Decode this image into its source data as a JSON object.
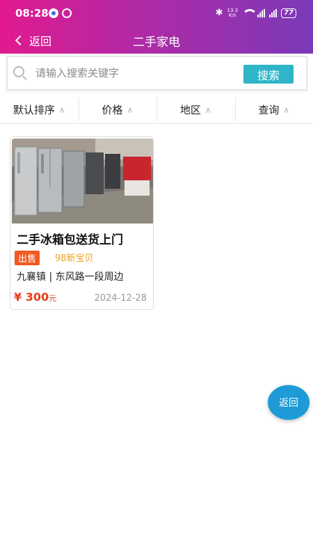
{
  "status_bar": {
    "time": "08:28",
    "network_speed_value": "13.3",
    "network_speed_unit": "K/s",
    "battery": "77"
  },
  "nav": {
    "back_label": "返回",
    "title": "二手家电"
  },
  "search": {
    "placeholder": "请输入搜索关键字",
    "value": "",
    "button_label": "搜索"
  },
  "filters": [
    {
      "label": "默认排序"
    },
    {
      "label": "价格"
    },
    {
      "label": "地区"
    },
    {
      "label": "查询"
    }
  ],
  "listings": [
    {
      "title": "二手冰箱包送货上门",
      "type_tag": "出售",
      "condition": "98新宝贝",
      "location": "九襄镇 | 东风路一段周边",
      "price_symbol": "¥",
      "price": "300",
      "price_unit": "元",
      "date": "2024-12-28"
    }
  ],
  "float_button": {
    "label": "返回"
  },
  "colors": {
    "header_gradient_start": "#e11a8e",
    "header_gradient_end": "#7a3ab8",
    "search_button": "#2fb5c7",
    "price": "#e0401e",
    "tag_sale": "#f15a23",
    "tag_condition": "#f0a018",
    "float_button": "#1e9bd7"
  }
}
